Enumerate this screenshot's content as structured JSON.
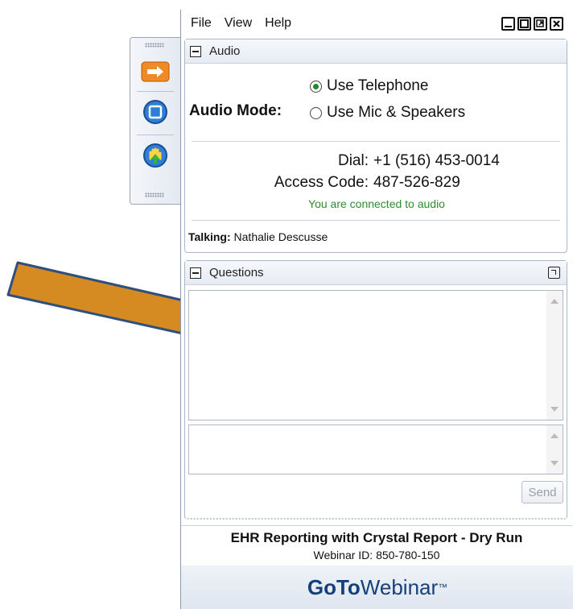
{
  "menu": {
    "file": "File",
    "view": "View",
    "help": "Help"
  },
  "audio": {
    "header": "Audio",
    "mode_label": "Audio Mode:",
    "options": [
      "Use Telephone",
      "Use Mic & Speakers"
    ],
    "selected": "Use Telephone",
    "dial_label": "Dial:",
    "dial_value": "+1 (516) 453-0014",
    "access_label": "Access Code:",
    "access_value": "487-526-829",
    "status": "You are connected to audio",
    "talking_label": "Talking:",
    "talking_name": "Nathalie Descusse"
  },
  "questions": {
    "header": "Questions",
    "send_label": "Send"
  },
  "footer": {
    "title": "EHR Reporting with Crystal Report - Dry Run",
    "webinar_id": "Webinar ID: 850-780-150"
  },
  "brand": {
    "bold": "GoTo",
    "rest": "Webinar",
    "tm": "™"
  },
  "colors": {
    "accent_green": "#2f8c2f",
    "brand_blue": "#15407a",
    "arrow_fill": "#d68a22",
    "arrow_stroke": "#2f4f80"
  },
  "icons": {
    "toolbar": [
      "orange-arrow-icon",
      "square-stop-icon",
      "raise-hand-icon"
    ]
  }
}
